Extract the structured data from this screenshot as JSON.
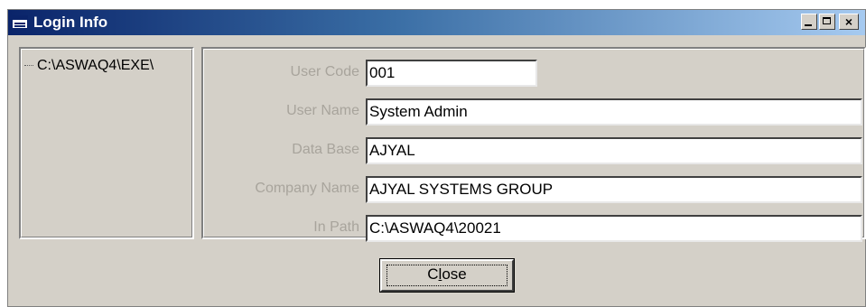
{
  "window": {
    "title": "Login Info",
    "controls": {
      "minimize_label": "",
      "maximize_label": "",
      "close_label": "×"
    }
  },
  "tree": {
    "path": "C:\\ASWAQ4\\EXE\\"
  },
  "form": {
    "fields": [
      {
        "label": "User Code",
        "value": "001"
      },
      {
        "label": "User Name",
        "value": "System Admin"
      },
      {
        "label": "Data Base",
        "value": "AJYAL"
      },
      {
        "label": "Company Name",
        "value": "AJYAL SYSTEMS GROUP"
      },
      {
        "label": "In Path",
        "value": "C:\\ASWAQ4\\20021"
      }
    ]
  },
  "actions": {
    "close_label_prefix": "C",
    "close_label_underlined": "l",
    "close_label_suffix": "ose"
  },
  "colors": {
    "face": "#d4d0c8",
    "title_start": "#0a246a",
    "title_end": "#a6caf0",
    "label_text": "#a8a49c"
  }
}
